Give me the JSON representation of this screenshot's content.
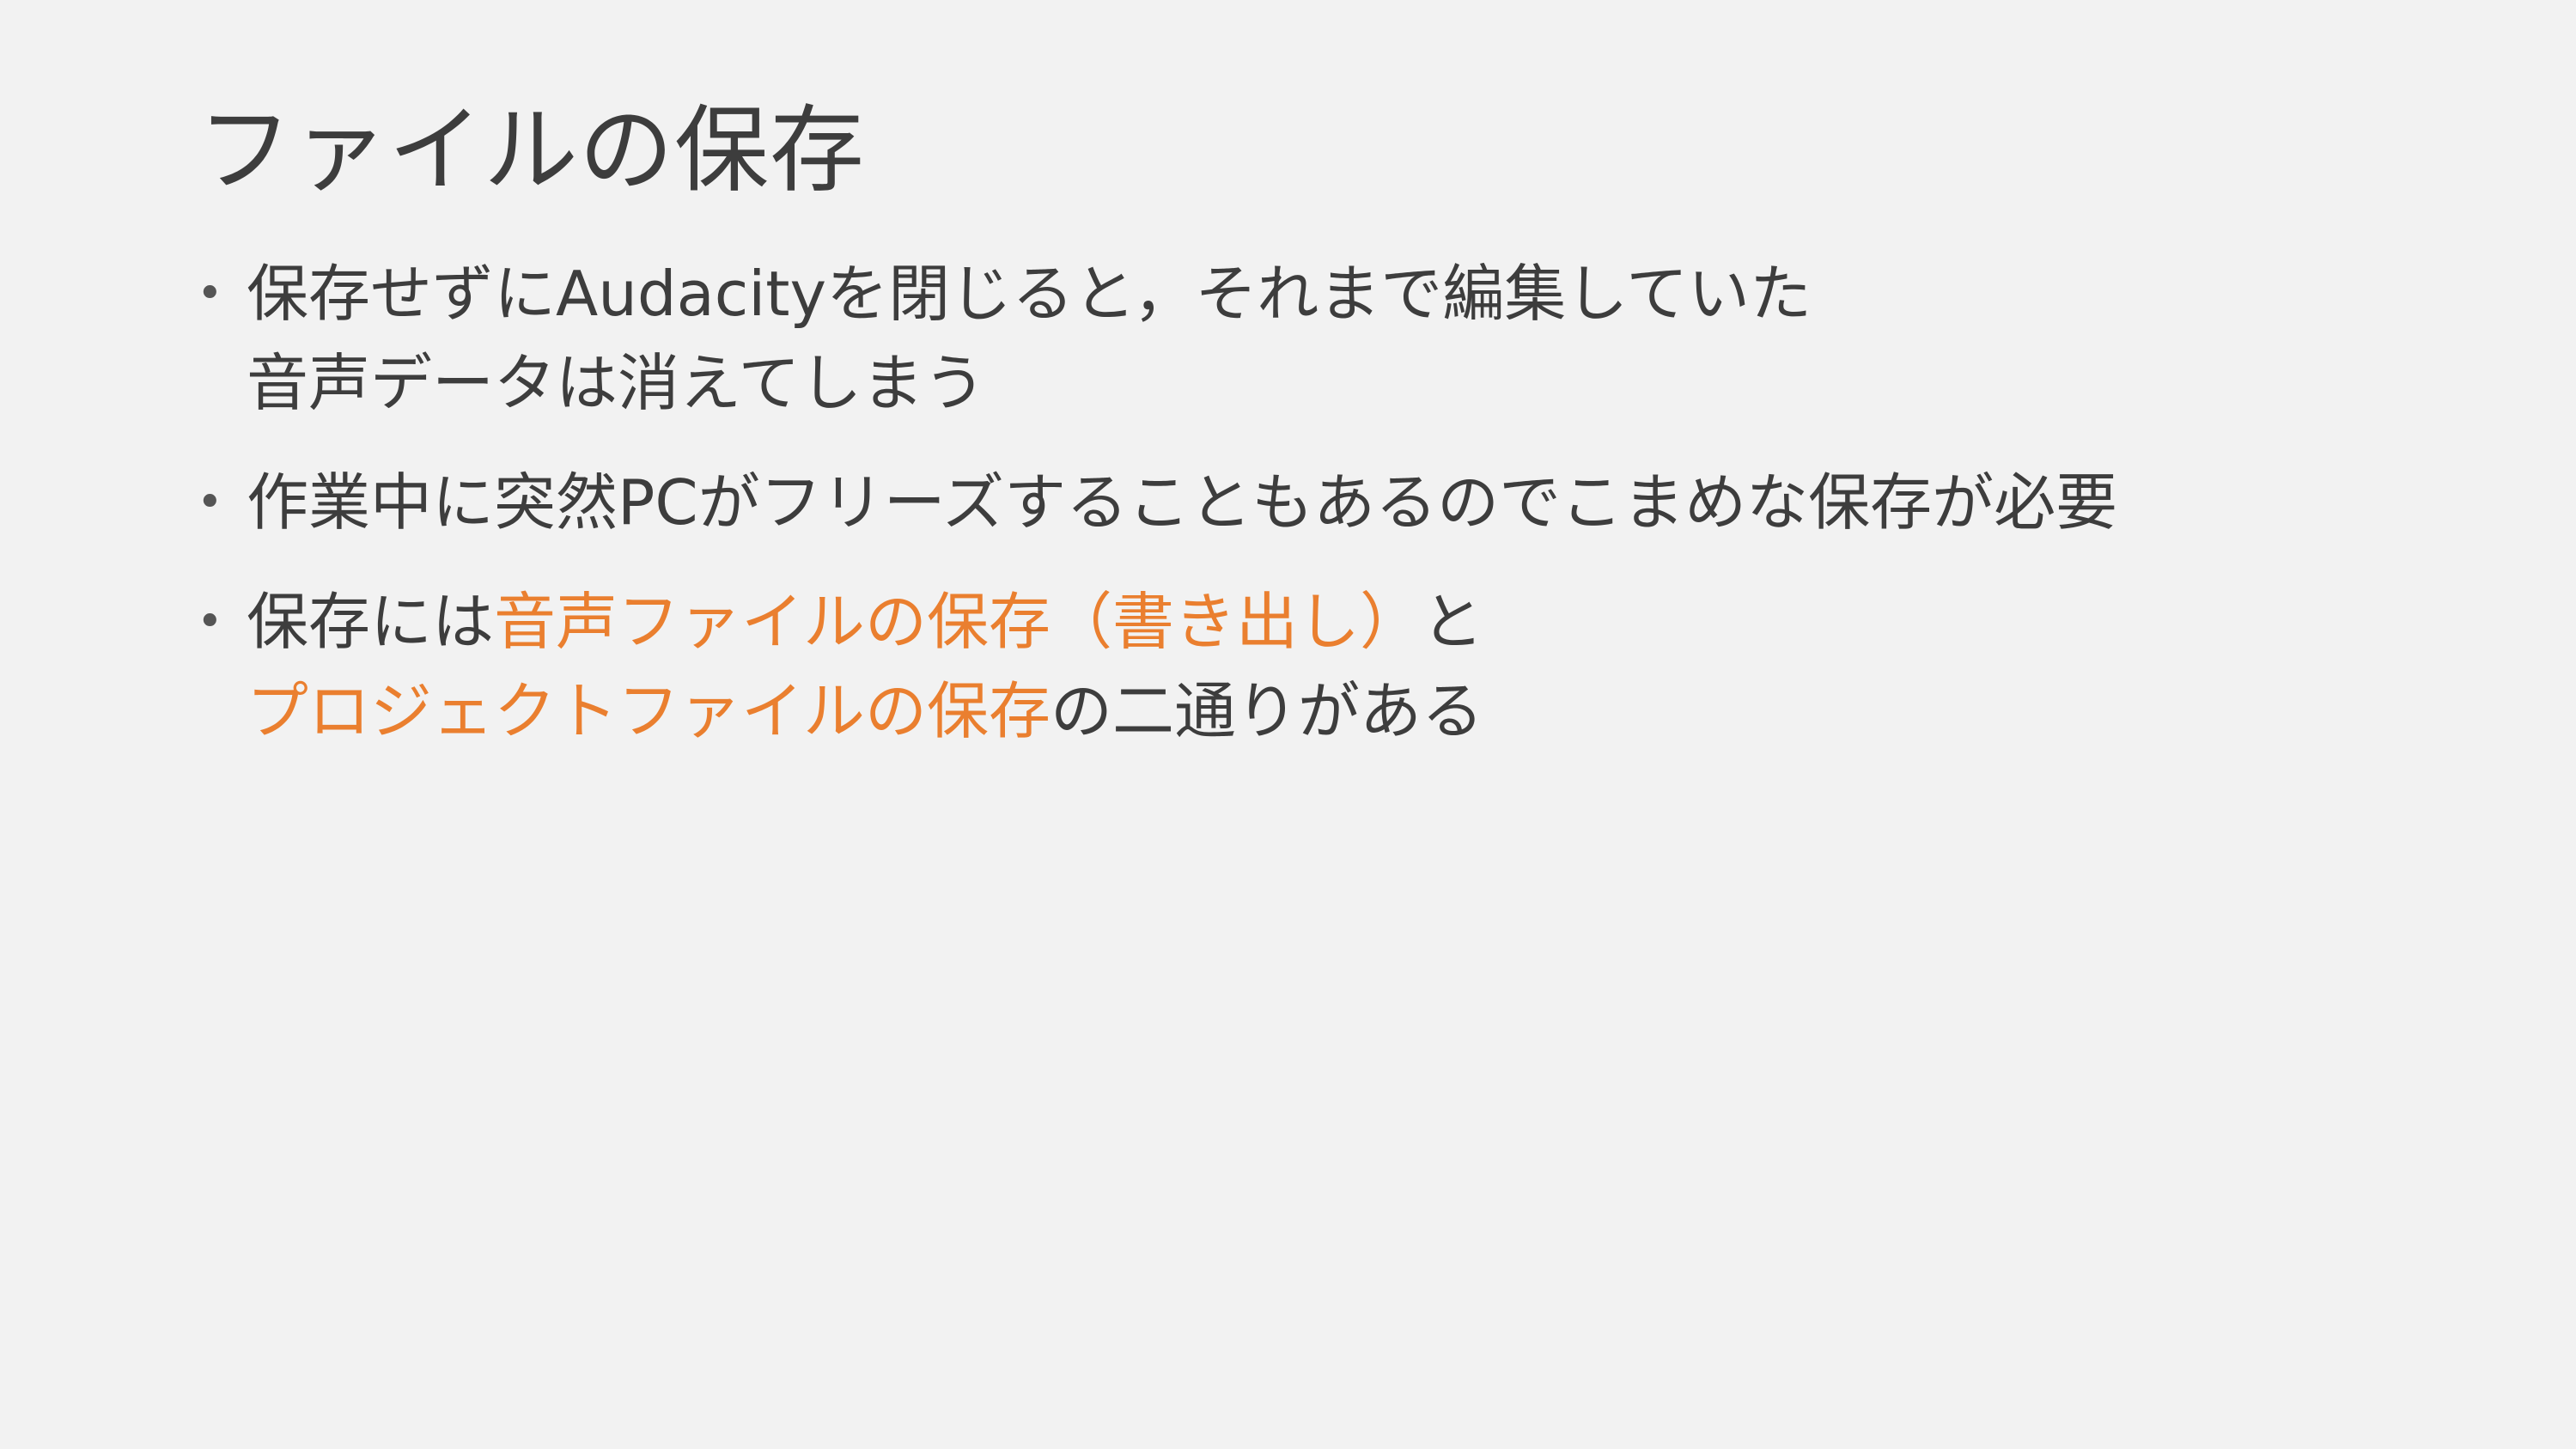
{
  "slide": {
    "title": "ファイルの保存",
    "bullets": [
      {
        "line1": "保存せずにAudacityを閉じると，それまで編集していた",
        "line2": "音声データは消えてしまう"
      },
      {
        "line1": "作業中に突然PCがフリーズすることもあるのでこまめな保存が必要"
      },
      {
        "line1_plain": "保存には",
        "line1_accent": "音声ファイルの保存（書き出し）",
        "line1_tail": "と",
        "line2_accent": "プロジェクトファイルの保存",
        "line2_tail": "の二通りがある"
      }
    ],
    "bullet_symbol": "•",
    "accent_color": "#ea7f2f",
    "text_color": "#3d3d3d",
    "background_color": "#f2f2f2"
  }
}
